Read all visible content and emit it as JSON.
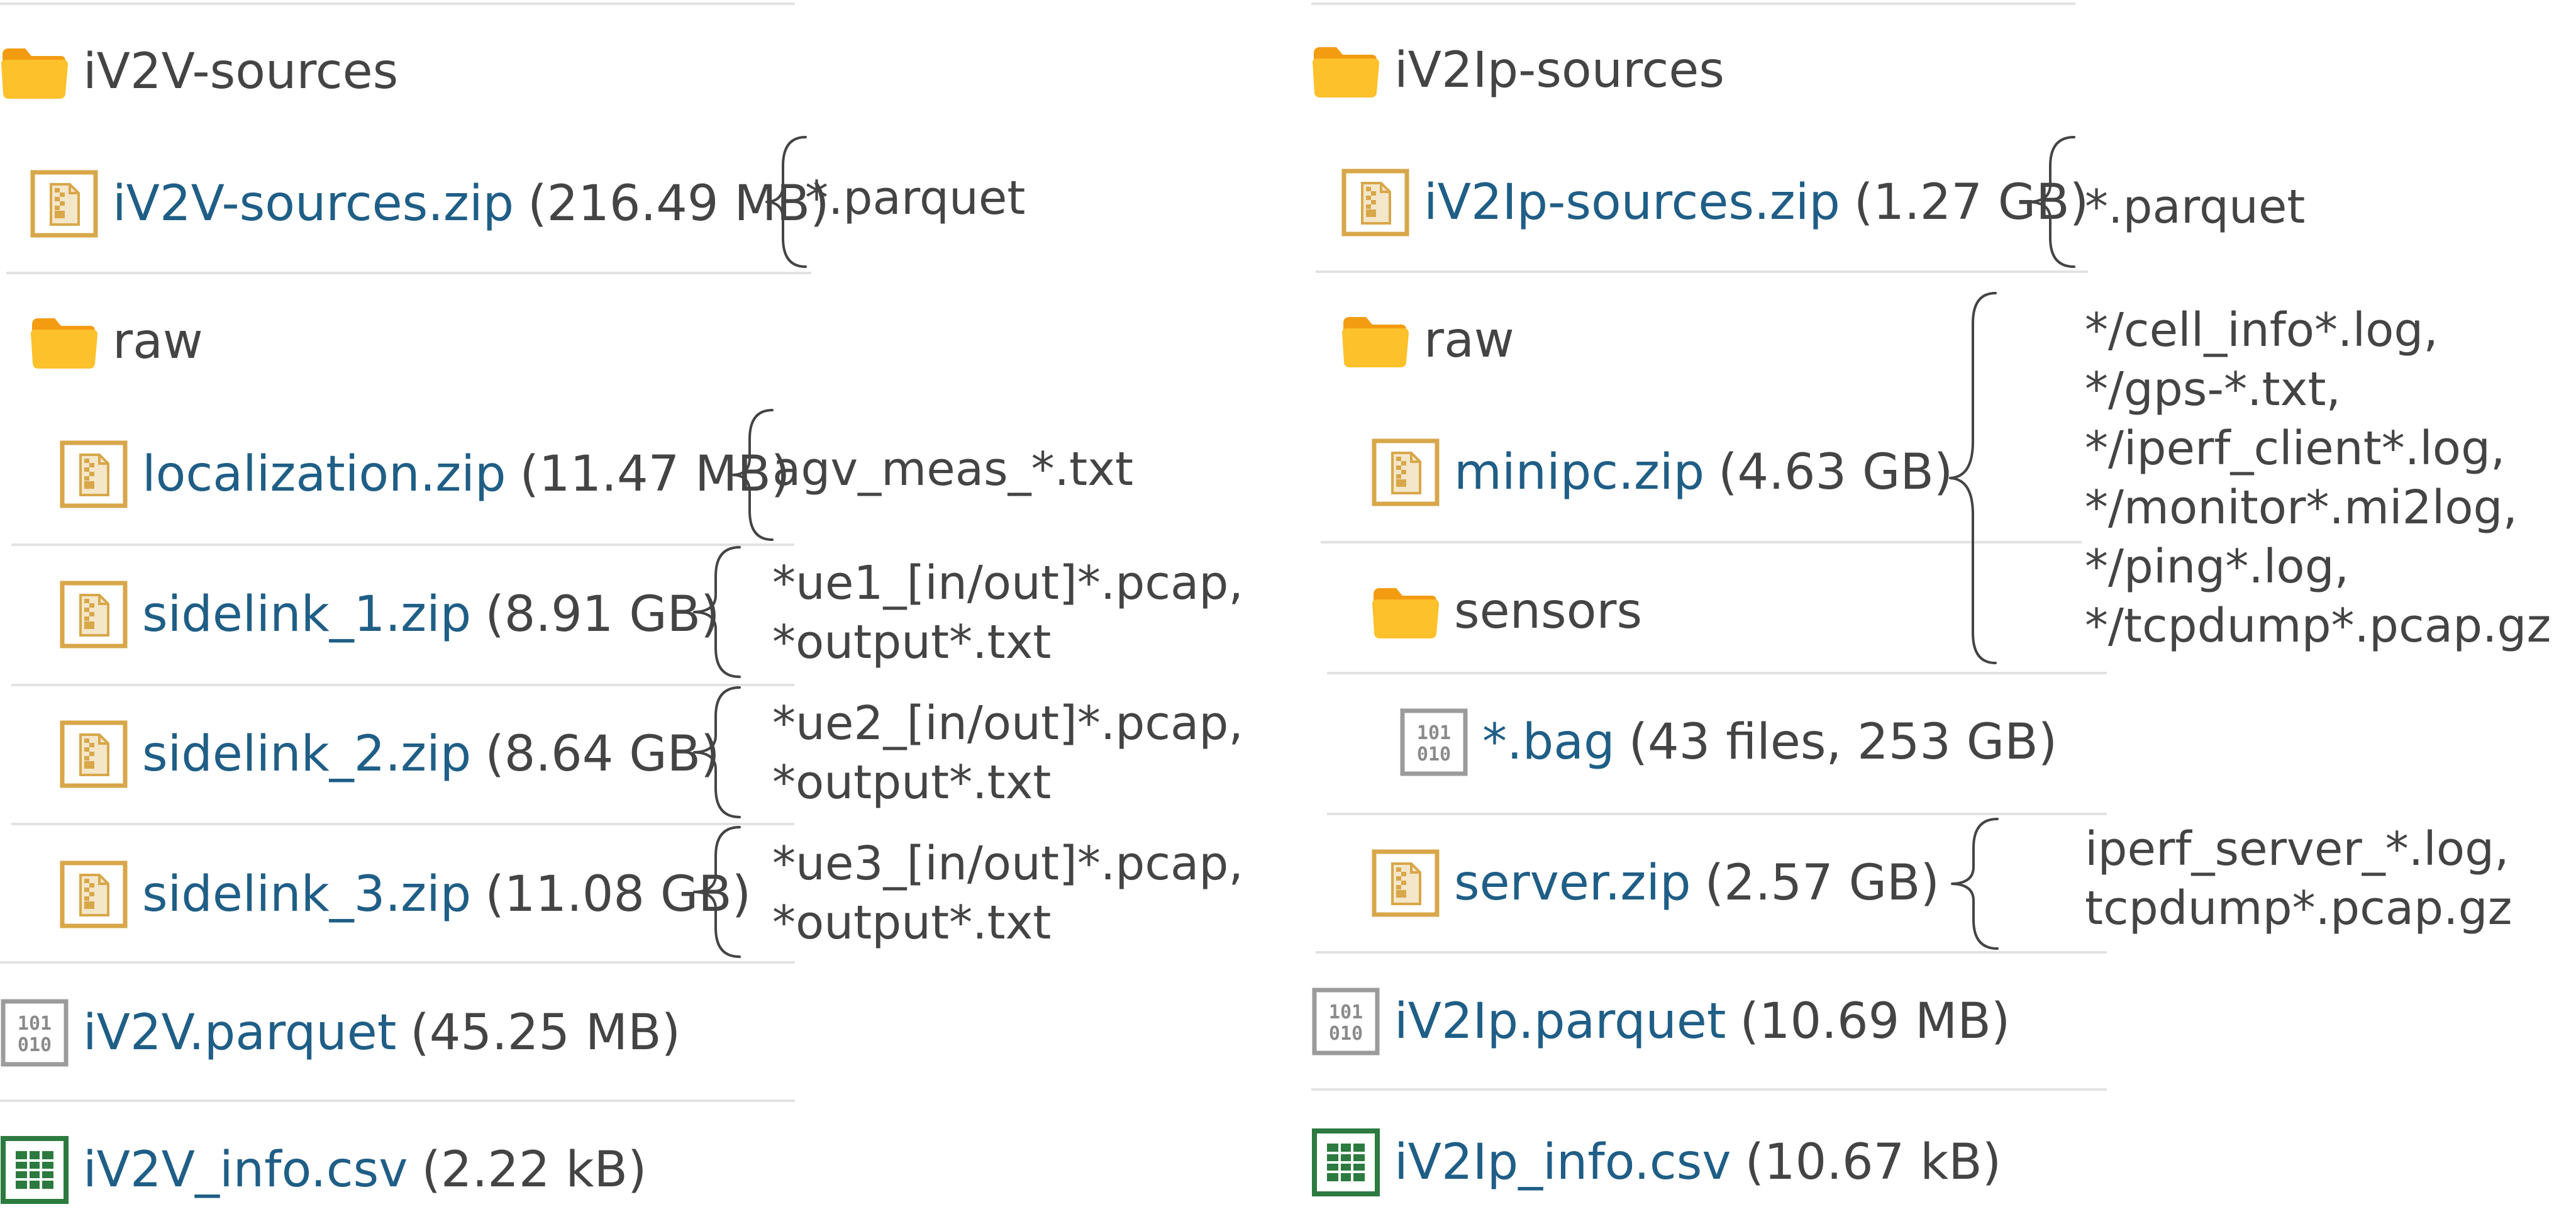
{
  "left": {
    "root": {
      "name": "iV2V-sources"
    },
    "sources_zip": {
      "name": "iV2V-sources.zip",
      "size": "(216.49 MB)",
      "contents": [
        "*.parquet"
      ]
    },
    "raw": {
      "name": "raw"
    },
    "localization": {
      "name": "localization.zip",
      "size": "(11.47 MB)",
      "contents": [
        "agv_meas_*.txt"
      ]
    },
    "sidelink_1": {
      "name": "sidelink_1.zip",
      "size": "(8.91 GB)",
      "contents": [
        "*ue1_[in/out]*.pcap,",
        "*output*.txt"
      ]
    },
    "sidelink_2": {
      "name": "sidelink_2.zip",
      "size": "(8.64 GB)",
      "contents": [
        "*ue2_[in/out]*.pcap,",
        "*output*.txt"
      ]
    },
    "sidelink_3": {
      "name": "sidelink_3.zip",
      "size": "(11.08 GB)",
      "contents": [
        "*ue3_[in/out]*.pcap,",
        "*output*.txt"
      ]
    },
    "parquet": {
      "name": "iV2V.parquet",
      "size": "(45.25 MB)"
    },
    "info_csv": {
      "name": "iV2V_info.csv",
      "size": "(2.22 kB)"
    }
  },
  "right": {
    "root": {
      "name": "iV2Ip-sources"
    },
    "sources_zip": {
      "name": "iV2Ip-sources.zip",
      "size": "(1.27 GB)",
      "contents": [
        "*.parquet"
      ]
    },
    "raw": {
      "name": "raw"
    },
    "minipc": {
      "name": "minipc.zip",
      "size": "(4.63 GB)",
      "contents": [
        "*/cell_info*.log,",
        "*/gps-*.txt,",
        "*/iperf_client*.log,",
        "*/monitor*.mi2log,",
        "*/ping*.log,",
        "*/tcpdump*.pcap.gz"
      ]
    },
    "sensors": {
      "name": "sensors"
    },
    "bag": {
      "name": "*.bag",
      "size": "(43 files, 253 GB)"
    },
    "server": {
      "name": "server.zip",
      "size": "(2.57 GB)",
      "contents": [
        "iperf_server_*.log,",
        "tcpdump*.pcap.gz"
      ]
    },
    "parquet": {
      "name": "iV2Ip.parquet",
      "size": "(10.69 MB)"
    },
    "info_csv": {
      "name": "iV2Ip_info.csv",
      "size": "(10.67 kB)"
    }
  },
  "colors": {
    "link": "#1f5e86",
    "text": "#444444",
    "folder": "#f7b21e",
    "zip_frame": "#d7a74a",
    "binary": "#9b9b9b",
    "spreadsheet": "#2c7a3f",
    "separator": "#e2e2e2"
  },
  "icons": {
    "folder": "folder-icon",
    "zip": "zip-archive-icon",
    "binary": "binary-file-icon",
    "spreadsheet": "spreadsheet-icon"
  }
}
